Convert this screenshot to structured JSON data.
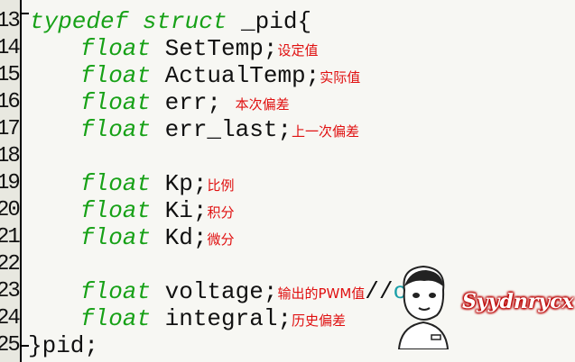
{
  "editor": {
    "lines": [
      {
        "num": "13",
        "kw": "typedef struct",
        "text": " _pid{",
        "ann": ""
      },
      {
        "num": "14",
        "kw": "float",
        "text": " SetTemp;",
        "ann": "设定值"
      },
      {
        "num": "15",
        "kw": "float",
        "text": " ActualTemp;",
        "ann": "实际值"
      },
      {
        "num": "16",
        "kw": "float",
        "text": " err;",
        "ann": "本次偏差"
      },
      {
        "num": "17",
        "kw": "float",
        "text": " err_last;",
        "ann": "上一次偏差"
      },
      {
        "num": "18",
        "kw": "",
        "text": "",
        "ann": ""
      },
      {
        "num": "19",
        "kw": "float",
        "text": " Kp;",
        "ann": "比例"
      },
      {
        "num": "20",
        "kw": "float",
        "text": " Ki;",
        "ann": "积分"
      },
      {
        "num": "21",
        "kw": "float",
        "text": " Kd;",
        "ann": "微分"
      },
      {
        "num": "22",
        "kw": "",
        "text": "",
        "ann": ""
      },
      {
        "num": "23",
        "kw": "float",
        "text": " voltage;",
        "ann": "输出的PWM值"
      },
      {
        "num": "24",
        "kw": "float",
        "text": " integral;",
        "ann": "历史偏差"
      },
      {
        "num": "25",
        "kw": "",
        "text": "}pid;",
        "ann": ""
      }
    ],
    "line23_tail_slash": "//",
    "line23_tail_text": "ou"
  },
  "watermark": {
    "text": "Syydnrycx"
  },
  "colors": {
    "keyword": "#17a117",
    "annotation": "#e01010",
    "background": "#f7f7f3"
  },
  "icons": {
    "avatar": "cartoon-avatar-icon"
  }
}
